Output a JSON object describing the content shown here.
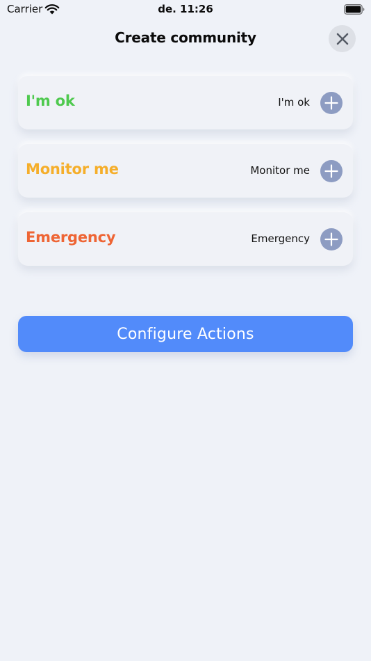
{
  "status_bar": {
    "carrier": "Carrier",
    "time": "de. 11:26",
    "wifi_icon": "wifi-icon",
    "battery_icon": "battery-icon"
  },
  "header": {
    "title": "Create community",
    "close_icon": "close-icon"
  },
  "cards": [
    {
      "label": "I'm ok",
      "value": "I'm ok",
      "color": "#4ec94e",
      "action_icon": "plus-icon"
    },
    {
      "label": "Monitor me",
      "value": "Monitor me",
      "color": "#f5ae2a",
      "action_icon": "plus-icon"
    },
    {
      "label": "Emergency",
      "value": "Emergency",
      "color": "#ee6535",
      "action_icon": "plus-icon"
    }
  ],
  "configure": {
    "label": "Configure Actions",
    "color": "#528bfa"
  },
  "theme": {
    "background": "#eff2f8",
    "add_button": "#8d9cc2"
  }
}
